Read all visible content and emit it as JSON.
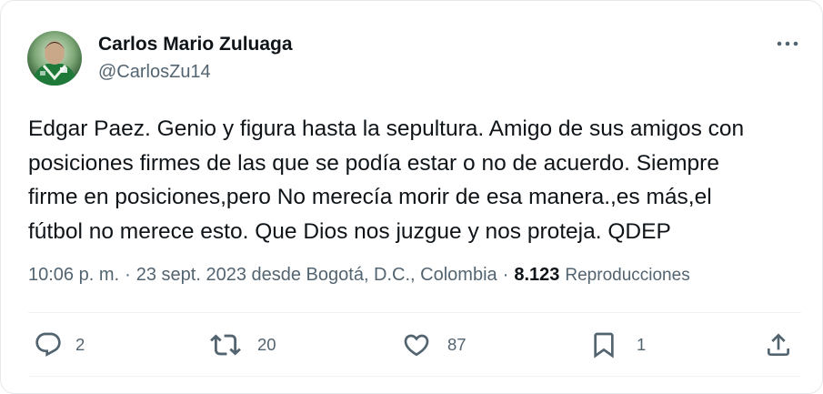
{
  "author": {
    "name": "Carlos Mario Zuluaga",
    "handle": "@CarlosZu14",
    "avatar_icon": "profile-photo"
  },
  "tweet": {
    "lines": [
      "Edgar Paez. Genio y figura hasta la sepultura. Amigo de sus amigos con",
      "posiciones firmes de las que se podía estar o no de acuerdo. Siempre",
      "firme en posiciones,pero No merecía morir de esa manera.,es más,el",
      "fútbol no merece esto. Que Dios nos juzgue y nos proteja. QDEP"
    ]
  },
  "meta": {
    "time": "10:06 p. m.",
    "date_location": "23 sept. 2023 desde Bogotá, D.C., Colombia",
    "separator": "·",
    "views_count": "8.123",
    "views_label": "Reproducciones"
  },
  "actions": {
    "reply": {
      "icon": "reply-icon",
      "count": "2"
    },
    "retweet": {
      "icon": "retweet-icon",
      "count": "20"
    },
    "like": {
      "icon": "heart-icon",
      "count": "87"
    },
    "bookmark": {
      "icon": "bookmark-icon",
      "count": "1"
    },
    "share": {
      "icon": "share-icon"
    }
  },
  "colors": {
    "text_primary": "#0f1419",
    "text_secondary": "#536471",
    "border": "#eff3f4"
  }
}
